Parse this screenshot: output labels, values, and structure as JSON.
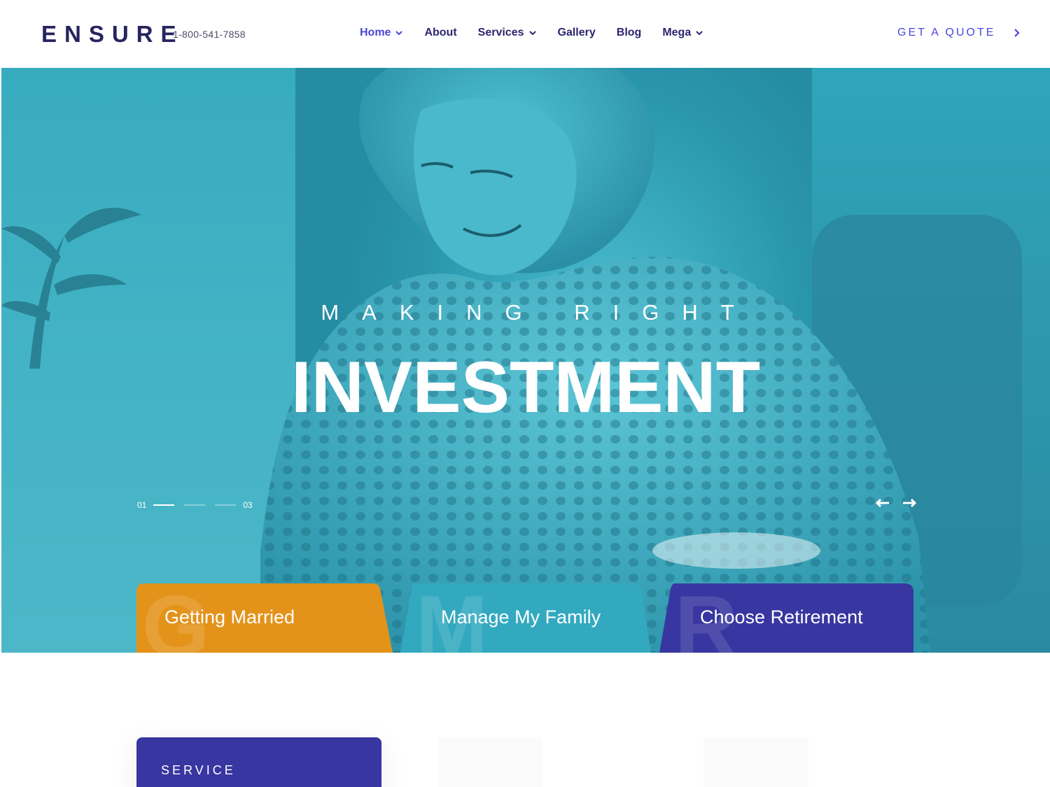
{
  "header": {
    "logo": "ENSURE",
    "phone": "1-800-541-7858",
    "nav": [
      {
        "label": "Home",
        "dropdown": true,
        "active": true
      },
      {
        "label": "About",
        "dropdown": false
      },
      {
        "label": "Services",
        "dropdown": true
      },
      {
        "label": "Gallery",
        "dropdown": false
      },
      {
        "label": "Blog",
        "dropdown": false
      },
      {
        "label": "Mega",
        "dropdown": true
      }
    ],
    "cta_label": "GET A QUOTE",
    "cta_icon": "chevron-right-icon"
  },
  "hero": {
    "kicker": "MAKING RIGHT",
    "title": "INVESTMENT",
    "slide_first": "01",
    "slide_last": "03",
    "slide_active_index": 1,
    "slide_count": 3,
    "prev_icon": "arrow-left-icon",
    "next_icon": "arrow-right-icon"
  },
  "cards": [
    {
      "label": "Getting Married",
      "letter": "G",
      "color": "#e3931a"
    },
    {
      "label": "Manage My Family",
      "letter": "M",
      "color": "#33a9bf"
    },
    {
      "label": "Choose Retirement",
      "letter": "R",
      "color": "#3836a0"
    }
  ],
  "section": {
    "service_label": "SERVICE"
  },
  "colors": {
    "brand_dark": "#27245f",
    "accent": "#4d46d9",
    "hero_teal": "#37a8bd",
    "orange": "#e3931a",
    "indigo": "#3836a0"
  }
}
